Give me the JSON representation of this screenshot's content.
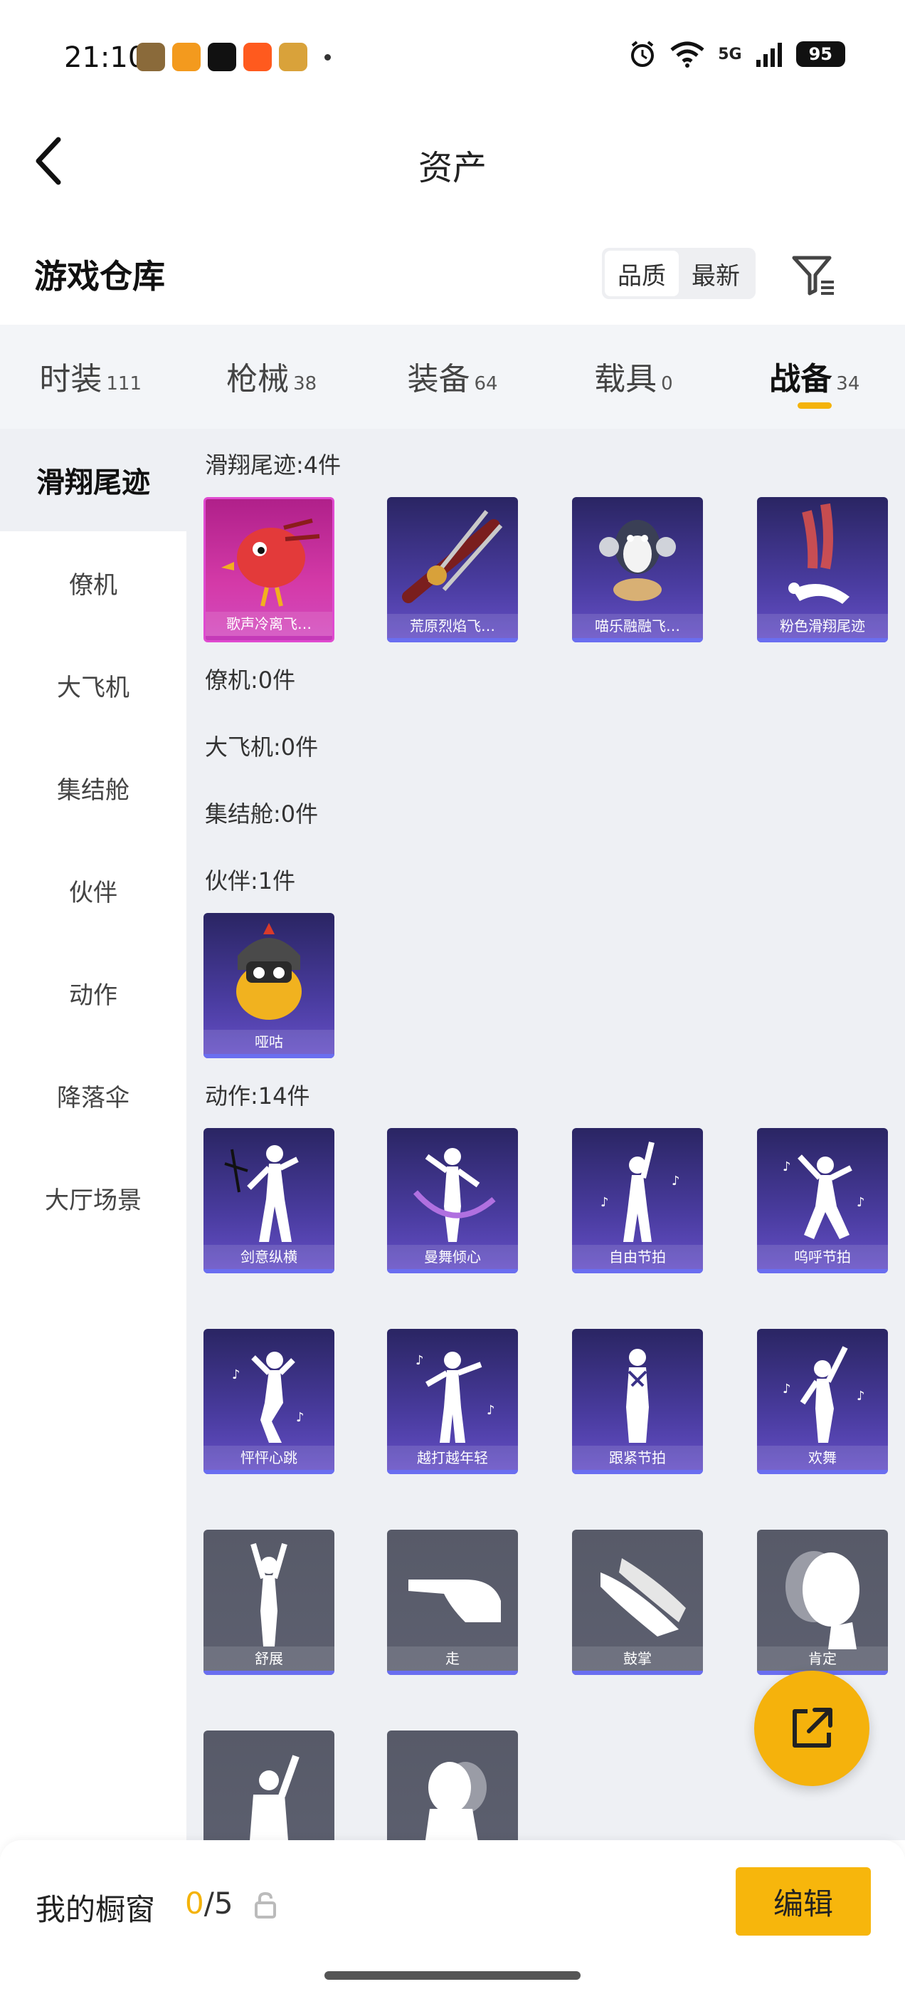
{
  "status_bar": {
    "time": "21:10",
    "app_icon_colors": [
      "#8a6a3a",
      "#f39a1e",
      "#111111",
      "#ff5a1e",
      "#d9a23a"
    ],
    "network": "5G",
    "battery": "95"
  },
  "header": {
    "title": "资产",
    "back_icon": "chevron-left-icon"
  },
  "warehouse": {
    "title": "游戏仓库",
    "sort_options": [
      "品质",
      "最新"
    ],
    "filter_icon": "filter-icon"
  },
  "tabs": [
    {
      "name": "时装",
      "count": "111"
    },
    {
      "name": "枪械",
      "count": "38"
    },
    {
      "name": "装备",
      "count": "64"
    },
    {
      "name": "载具",
      "count": "0"
    },
    {
      "name": "战备",
      "count": "34"
    }
  ],
  "active_tab": 4,
  "sidebar": [
    "滑翔尾迹",
    "僚机",
    "大飞机",
    "集结舱",
    "伙伴",
    "动作",
    "降落伞",
    "大厅场景"
  ],
  "sections": {
    "glide": {
      "title": "滑翔尾迹:4件",
      "items": [
        "歌声冷离飞…",
        "荒原烈焰飞…",
        "喵乐融融飞…",
        "粉色滑翔尾迹"
      ]
    },
    "wingman": {
      "title": "僚机:0件"
    },
    "plane": {
      "title": "大飞机:0件"
    },
    "pod": {
      "title": "集结舱:0件"
    },
    "buddy": {
      "title": "伙伴:1件",
      "items": [
        "哑咕"
      ]
    },
    "emote": {
      "title": "动作:14件",
      "items": [
        "剑意纵横",
        "曼舞倾心",
        "自由节拍",
        "呜呼节拍",
        "怦怦心跳",
        "越打越年轻",
        "跟紧节拍",
        "欢舞",
        "舒展",
        "走",
        "鼓掌",
        "肯定",
        "",
        ""
      ]
    }
  },
  "colors": {
    "accent": "#f4b30b",
    "card_purple": "#3a3288",
    "card_grey": "#5a5d6b",
    "stripe": "#6a6ef0"
  },
  "bottom": {
    "showcase_label": "我的橱窗",
    "showcase_current": "0",
    "showcase_total": "/5",
    "lock_icon": "lock-icon",
    "edit_label": "编辑"
  },
  "fab_icon": "share-external-icon"
}
